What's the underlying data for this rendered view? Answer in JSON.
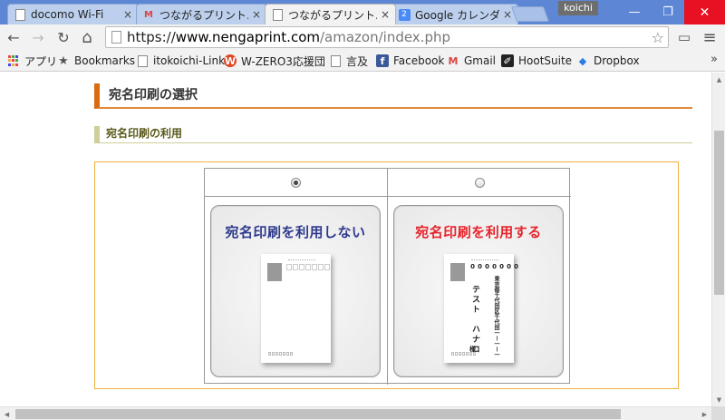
{
  "browser": {
    "tabs": [
      {
        "title": "docomo Wi-Fi",
        "favicon": "page-icon",
        "close": "×"
      },
      {
        "title": "つながるプリント.com",
        "favicon": "gmail-icon",
        "close": "×"
      },
      {
        "title": "つながるプリント.com",
        "favicon": "page-icon",
        "close": "×",
        "active": true
      },
      {
        "title": "Google カレンダー - ",
        "favicon": "calendar-icon",
        "favicon_text": "2",
        "close": "×"
      }
    ],
    "user": "koichi",
    "window_controls": {
      "minimize": "—",
      "maximize": "❐",
      "close": "✕"
    },
    "nav": {
      "back": "←",
      "forward": "→",
      "reload": "↻",
      "home": "⌂"
    },
    "url": {
      "scheme": "https://",
      "host": "www.nengaprint.com",
      "path": "/amazon/index.php"
    },
    "star": "☆",
    "cast": "▭",
    "menu": "≡",
    "bookmarks": [
      {
        "label": "アプリ",
        "icon": "apps-icon"
      },
      {
        "label": "Bookmarks",
        "icon": "star-icon",
        "glyph": "★"
      },
      {
        "label": "itokoichi-Link",
        "icon": "page-icon"
      },
      {
        "label": "W-ZERO3応援団",
        "icon": "wzero3-icon",
        "glyph": "W"
      },
      {
        "label": "言及",
        "icon": "page-icon"
      },
      {
        "label": "Facebook",
        "icon": "facebook-icon",
        "glyph": "f"
      },
      {
        "label": "Gmail",
        "icon": "gmail-icon",
        "glyph": "M"
      },
      {
        "label": "HootSuite",
        "icon": "hootsuite-icon",
        "glyph": "✐"
      },
      {
        "label": "Dropbox",
        "icon": "dropbox-icon",
        "glyph": "◆"
      }
    ],
    "bookmarks_more": "»",
    "tab_gmail_glyph": "M"
  },
  "page": {
    "section_title": "宛名印刷の選択",
    "sub_title": "宛名印刷の利用",
    "options": [
      {
        "label": "宛名印刷を利用しない",
        "selected": true,
        "color": "#2e3a8c"
      },
      {
        "label": "宛名印刷を利用する",
        "selected": false,
        "color": "#e8232b",
        "sample_zip": [
          "0",
          "0",
          "0",
          "0",
          "0",
          "0",
          "0"
        ],
        "sample_address": "東京都千代田区千代田一ー一ー一",
        "sample_name": "テスト　ハナコ",
        "sample_honorific": "様"
      }
    ]
  },
  "scrollbars": {
    "up": "▲",
    "down": "▼",
    "left": "◀",
    "right": "▶"
  }
}
